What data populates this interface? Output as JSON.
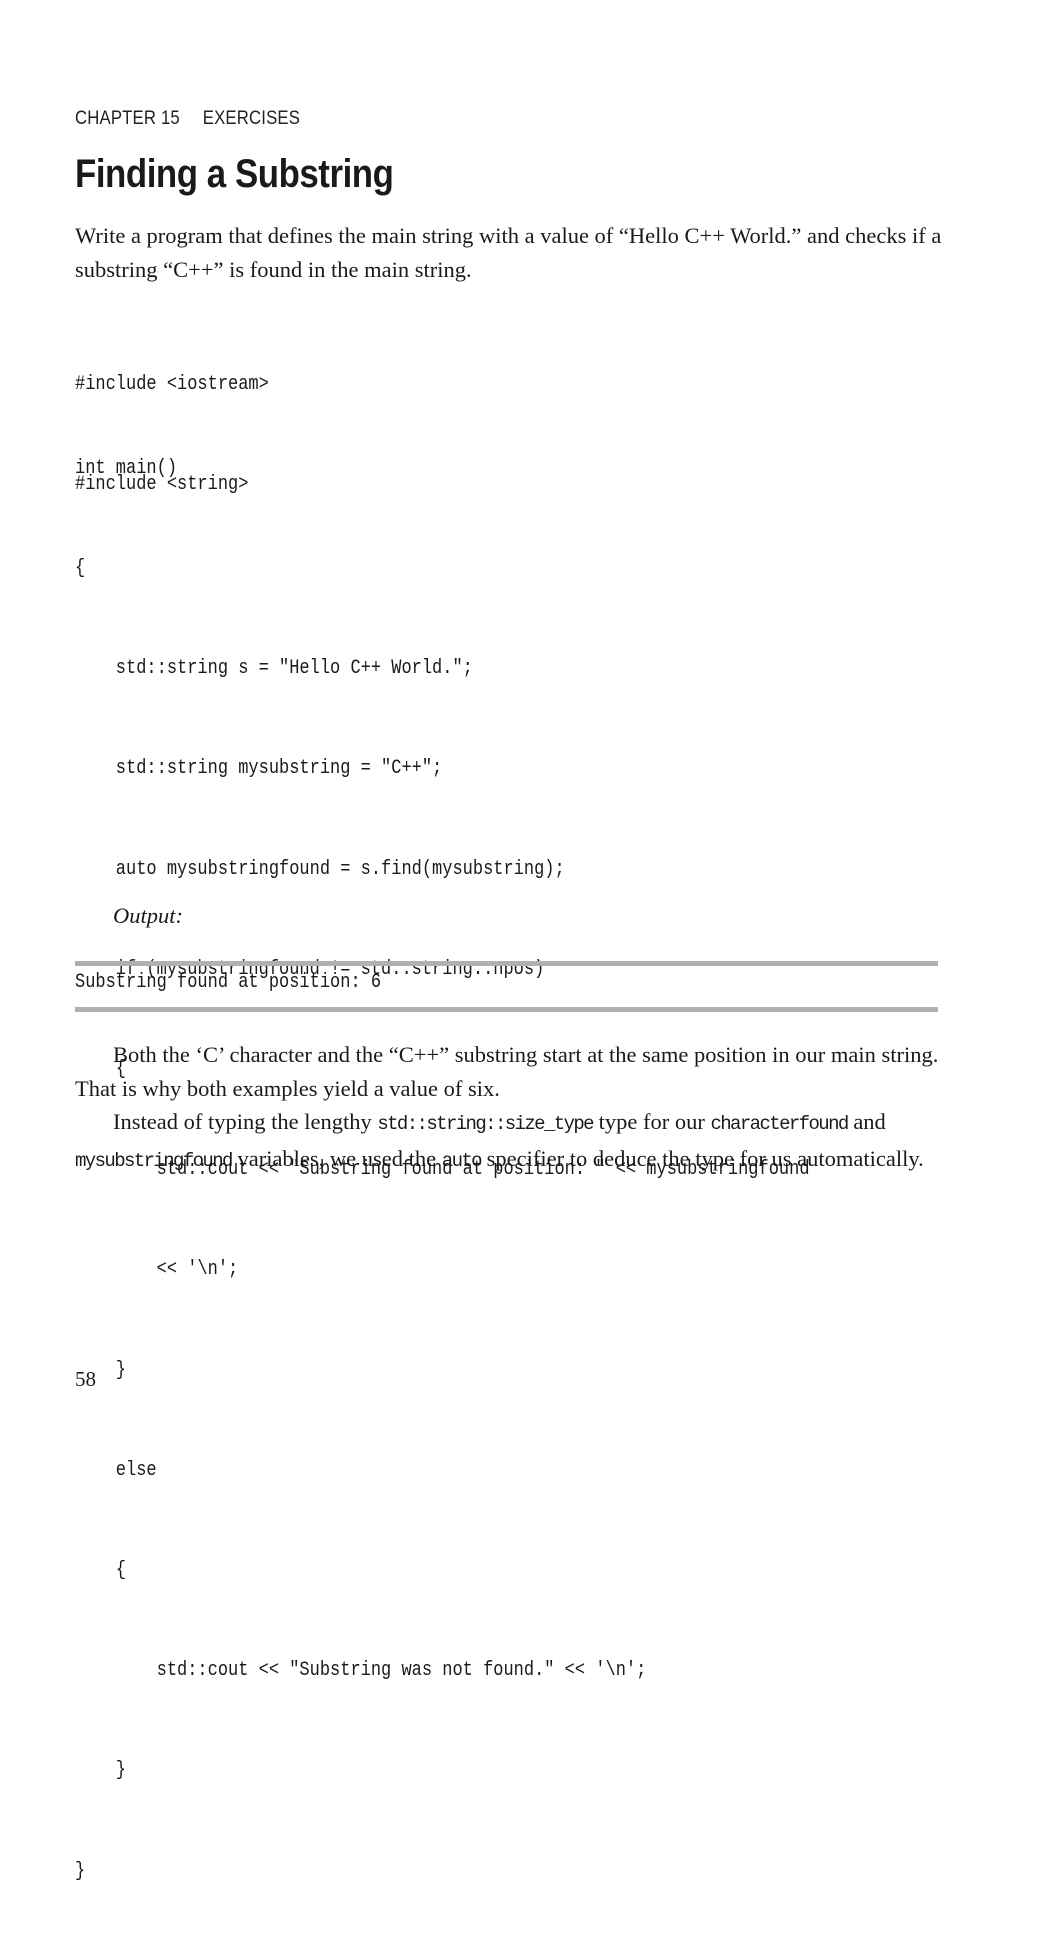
{
  "header": {
    "chapter": "CHAPTER 15",
    "section": "EXERCISES"
  },
  "title": "Finding a Substring",
  "intro": "Write a program that defines the main string with a value of “Hello C++ World.” and checks if a substring “C++” is found in the main string.",
  "code_block_1": [
    "#include <iostream>",
    "#include <string>"
  ],
  "code_block_2": [
    "int main()",
    "{",
    "    std::string s = \"Hello C++ World.\";",
    "    std::string mysubstring = \"C++\";",
    "    auto mysubstringfound = s.find(mysubstring);",
    "    if (mysubstringfound != std::string::npos)",
    "    {",
    "        std::cout << \"Substring found at position: \" << mysubstringfound",
    "        << '\\n';",
    "    }",
    "    else",
    "    {",
    "        std::cout << \"Substring was not found.\" << '\\n';",
    "    }",
    "}"
  ],
  "output_label": "Output:",
  "output_text": "Substring found at position: 6",
  "paragraph_1": "Both the ‘C’ character and the “C++” substring start at the same position in our main string. That is why both examples yield a value of six.",
  "paragraph_2": {
    "t1": "Instead of typing the lengthy ",
    "c1": "std::string::size_type",
    "t2": " type for our ",
    "c2": "characterfound",
    "t3": " and ",
    "c3": "mysubstringfound",
    "t4": " variables, we used the ",
    "c4": "auto",
    "t5": " specifier to deduce the type for us automatically."
  },
  "page_number": "58"
}
